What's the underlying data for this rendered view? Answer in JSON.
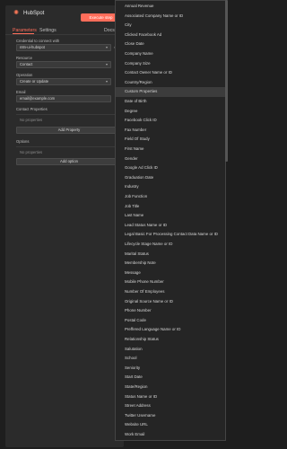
{
  "header": {
    "app": "HubSpot",
    "execute_label": "Execute step",
    "logo_icon": "hubspot-icon"
  },
  "tabs": [
    {
      "label": "Parameters",
      "active": true
    },
    {
      "label": "Settings",
      "active": false
    },
    {
      "label": "Docs",
      "active": false
    }
  ],
  "form": {
    "credential_label": "Credential to connect with",
    "credential_value": "n8n-ui-hubspot",
    "resource_label": "Resource",
    "resource_value": "Contact",
    "operation_label": "Operation",
    "operation_value": "Create or Update",
    "email_label": "Email",
    "email_value": "email@example.com",
    "contact_props_label": "Contact Properties",
    "no_props": "No properties",
    "add_property_label": "Add Property",
    "options_label": "Options",
    "no_options": "No properties",
    "add_option_label": "Add option"
  },
  "dropdown": {
    "highlighted_index": 9,
    "items": [
      "Annual Revenue",
      "Associated Company Name or ID",
      "City",
      "Clicked Facebook Ad",
      "Close Date",
      "Company Name",
      "Company Size",
      "Contact Owner Name or ID",
      "Country/Region",
      "Custom Properties",
      "Date of Birth",
      "Degree",
      "Facebook Click ID",
      "Fax Number",
      "Field Of Study",
      "First Name",
      "Gender",
      "Google Ad Click ID",
      "Graduation Date",
      "Industry",
      "Job Function",
      "Job Title",
      "Last Name",
      "Lead Status Name or ID",
      "Legal Basic For Processing Contact Data Name or ID",
      "Lifecycle Stage Name or ID",
      "Marital Status",
      "Membership Note",
      "Message",
      "Mobile Phone Number",
      "Number Of Employees",
      "Original Source Name or ID",
      "Phone Number",
      "Postal Code",
      "Preffered Language Name or ID",
      "Relationship Status",
      "Salutation",
      "School",
      "Seniority",
      "Start Date",
      "State/Region",
      "Status Name or ID",
      "Street Address",
      "Twitter Username",
      "Website URL",
      "Work Email"
    ]
  }
}
